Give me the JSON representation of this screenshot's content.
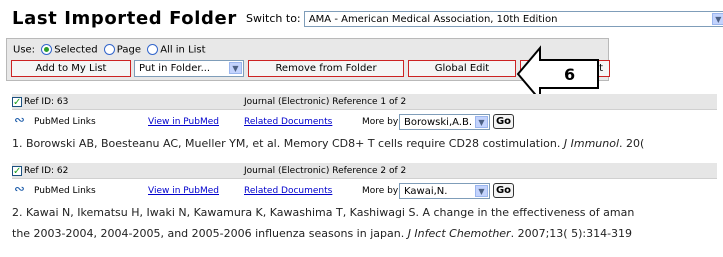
{
  "header": {
    "title": "Last Imported Folder",
    "switch_label": "Switch to:",
    "style_select": "AMA - American Medical Association, 10th Edition"
  },
  "toolbar": {
    "use_label": "Use:",
    "radios": [
      {
        "label": "Selected",
        "checked": true
      },
      {
        "label": "Page",
        "checked": false
      },
      {
        "label": "All in List",
        "checked": false
      }
    ],
    "add_button": "Add to My List",
    "folder_select": "Put in Folder...",
    "remove_button": "Remove from Folder",
    "global_edit_button": "Global Edit",
    "print_button_partial": "int"
  },
  "callout": {
    "number": "6"
  },
  "records": [
    {
      "ref_id": "Ref ID: 63",
      "ref_type": "Journal (Electronic) Reference 1 of 2",
      "pubmed_links": "PubMed Links",
      "view_in_pubmed": "View in PubMed",
      "related_documents": "Related Documents",
      "more_by": "More by",
      "author_select": "Borowski,A.B.",
      "go": "Go",
      "citation_lines": [
        {
          "text": "1. Borowski AB, Boesteanu AC, Mueller YM, et al. Memory CD8+ T cells require CD28 costimulation. ",
          "italic": "J Immunol",
          "tail": ". 20("
        }
      ]
    },
    {
      "ref_id": "Ref ID: 62",
      "ref_type": "Journal (Electronic) Reference 2 of 2",
      "pubmed_links": "PubMed Links",
      "view_in_pubmed": "View in PubMed",
      "related_documents": "Related Documents",
      "more_by": "More by",
      "author_select": "Kawai,N.",
      "go": "Go",
      "citation_lines": [
        {
          "text": "2. Kawai N, Ikematsu H, Iwaki N, Kawamura K, Kawashima T, Kashiwagi S. A change in the effectiveness of aman",
          "italic": "",
          "tail": ""
        },
        {
          "text": "the 2003-2004, 2004-2005, and 2005-2006 influenza seasons in japan. ",
          "italic": "J Infect Chemother",
          "tail": ". 2007;13( 5):314-319"
        }
      ]
    }
  ]
}
